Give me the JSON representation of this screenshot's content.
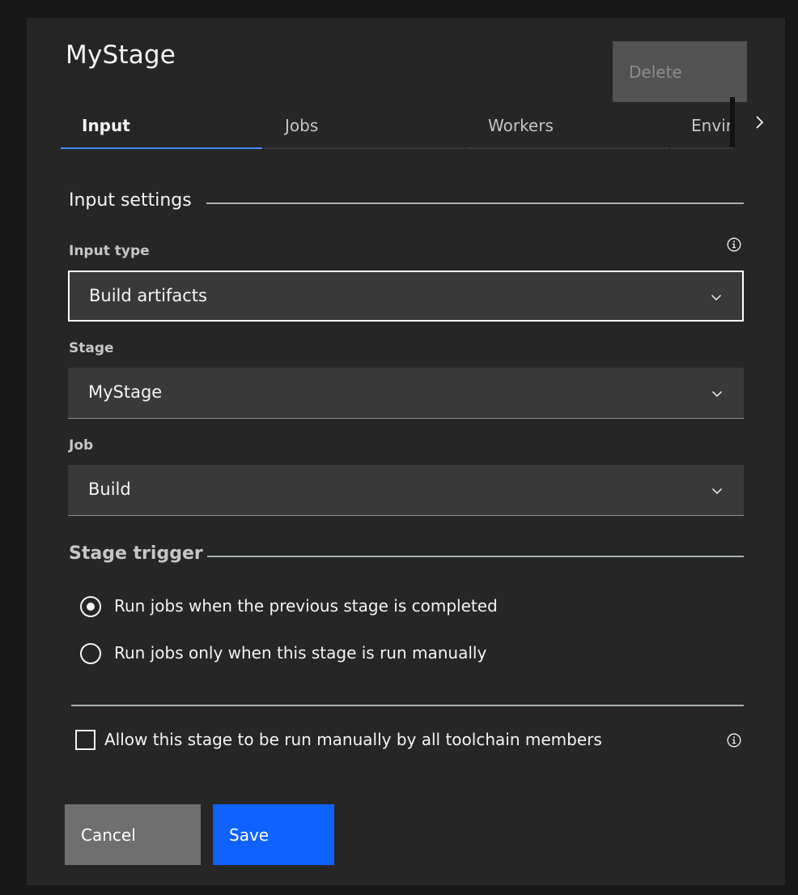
{
  "dialog": {
    "title": "MyStage",
    "delete_label": "Delete"
  },
  "tabs": [
    {
      "label": "Input",
      "active": true
    },
    {
      "label": "Jobs",
      "active": false
    },
    {
      "label": "Workers",
      "active": false
    },
    {
      "label": "Envir",
      "active": false
    }
  ],
  "input_settings": {
    "heading": "Input settings",
    "input_type": {
      "label": "Input type",
      "value": "Build artifacts"
    },
    "stage": {
      "label": "Stage",
      "value": "MyStage"
    },
    "job": {
      "label": "Job",
      "value": "Build"
    }
  },
  "stage_trigger": {
    "heading": "Stage trigger",
    "options": [
      {
        "label": "Run jobs when the previous stage is completed",
        "checked": true
      },
      {
        "label": "Run jobs only when this stage is run manually",
        "checked": false
      }
    ],
    "allow_manual": {
      "label": "Allow this stage to be run manually by all toolchain members",
      "checked": false
    }
  },
  "footer": {
    "cancel_label": "Cancel",
    "save_label": "Save"
  },
  "colors": {
    "primary": "#0f62fe",
    "active_tab": "#4589ff",
    "panel_bg": "#262626"
  },
  "icons": {
    "tab_next": "chevron-right-icon",
    "select": "chevron-down-icon",
    "info": "information-icon"
  }
}
